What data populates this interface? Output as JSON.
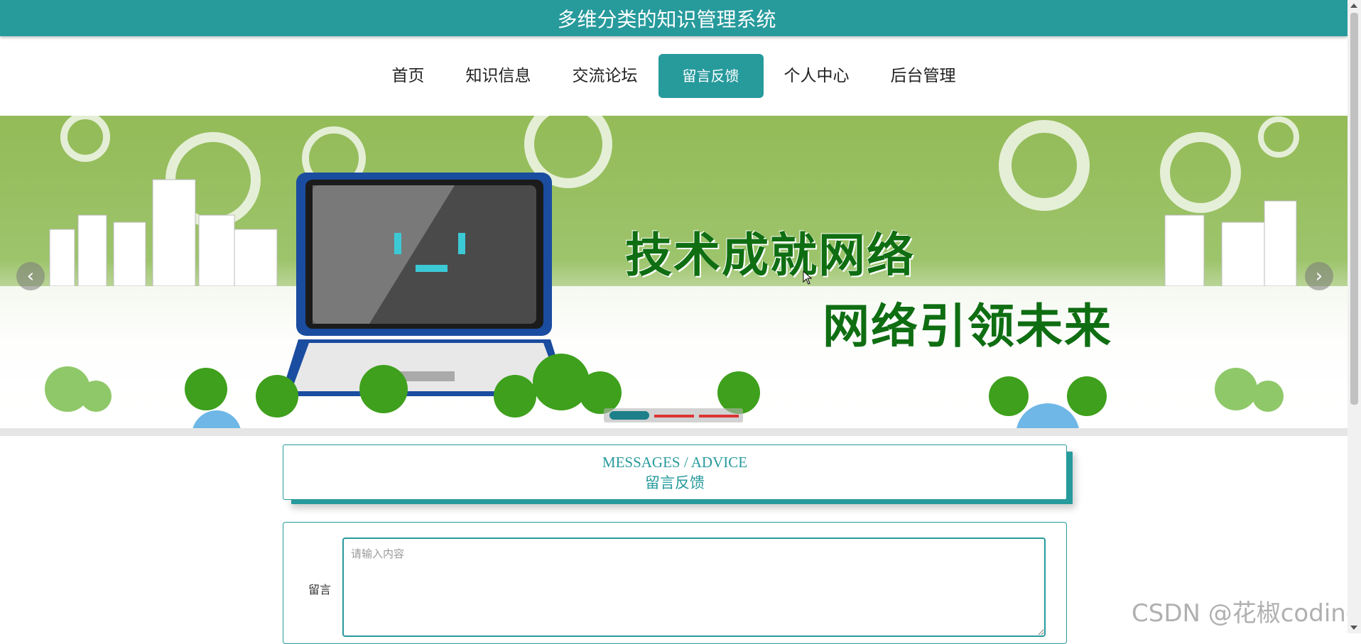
{
  "header": {
    "title": "多维分类的知识管理系统"
  },
  "nav": {
    "items": [
      {
        "label": "首页"
      },
      {
        "label": "知识信息"
      },
      {
        "label": "交流论坛"
      },
      {
        "label": "留言反馈",
        "active": true
      },
      {
        "label": "个人中心"
      },
      {
        "label": "后台管理"
      }
    ]
  },
  "banner": {
    "line1": "技术成就网络",
    "line2": "网络引领未来",
    "prev_icon": "chevron-left-icon",
    "next_icon": "chevron-right-icon",
    "slides_count": 3,
    "active_slide": 1
  },
  "section": {
    "title_en": "MESSAGES / ADVICE",
    "title_zh": "留言反馈"
  },
  "form": {
    "label": "留言",
    "placeholder": "请输入内容",
    "value": ""
  },
  "watermark": "CSDN @花椒coding",
  "colors": {
    "accent": "#279a9c",
    "banner_text": "#0f6e12"
  }
}
